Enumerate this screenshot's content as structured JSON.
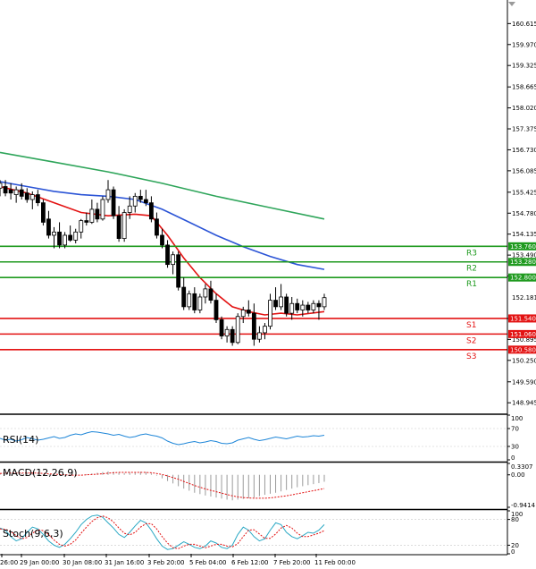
{
  "chart_data": {
    "type": "candlestick",
    "price_axis_ticks": [
      "160.615",
      "159.970",
      "159.325",
      "158.665",
      "158.020",
      "157.375",
      "156.730",
      "156.085",
      "155.425",
      "154.780",
      "154.135",
      "153.490",
      "152.845",
      "152.181",
      "151.540",
      "150.895",
      "150.250",
      "149.590",
      "148.945"
    ],
    "price_range": [
      148.62,
      161.12
    ],
    "current_price": "152.181",
    "time_labels": [
      "26:00",
      "29 Jan 00:00",
      "30 Jan 08:00",
      "31 Jan 16:00",
      "3 Feb 20:00",
      "5 Feb 04:00",
      "6 Feb 12:00",
      "7 Feb 20:00",
      "11 Feb 00:00"
    ],
    "levels": [
      {
        "name": "R3",
        "value": 153.76,
        "tag": "153.760",
        "kind": "resistance",
        "color": "#1f9a1f"
      },
      {
        "name": "R2",
        "value": 153.28,
        "tag": "153.280",
        "kind": "resistance",
        "color": "#1f9a1f"
      },
      {
        "name": "R1",
        "value": 152.8,
        "tag": "152.800",
        "kind": "resistance",
        "color": "#1f9a1f"
      },
      {
        "name": "S1",
        "value": 151.54,
        "tag": "151.540",
        "kind": "support",
        "color": "#e31212"
      },
      {
        "name": "S2",
        "value": 151.06,
        "tag": "151.060",
        "kind": "support",
        "color": "#e31212"
      },
      {
        "name": "S3",
        "value": 150.58,
        "tag": "150.580",
        "kind": "support",
        "color": "#e31212"
      }
    ],
    "candles": [
      {
        "o": 155.55,
        "h": 155.8,
        "l": 155.3,
        "c": 155.7
      },
      {
        "o": 155.6,
        "h": 155.8,
        "l": 155.3,
        "c": 155.4
      },
      {
        "o": 155.5,
        "h": 155.7,
        "l": 155.2,
        "c": 155.4
      },
      {
        "o": 155.35,
        "h": 155.6,
        "l": 155.1,
        "c": 155.5
      },
      {
        "o": 155.5,
        "h": 155.7,
        "l": 155.2,
        "c": 155.3
      },
      {
        "o": 155.4,
        "h": 155.55,
        "l": 155.1,
        "c": 155.2
      },
      {
        "o": 155.2,
        "h": 155.45,
        "l": 154.9,
        "c": 155.35
      },
      {
        "o": 155.35,
        "h": 155.5,
        "l": 155.0,
        "c": 155.1
      },
      {
        "o": 155.1,
        "h": 155.2,
        "l": 154.4,
        "c": 154.5
      },
      {
        "o": 154.6,
        "h": 154.85,
        "l": 154.0,
        "c": 154.1
      },
      {
        "o": 154.1,
        "h": 154.35,
        "l": 153.7,
        "c": 154.2
      },
      {
        "o": 154.2,
        "h": 154.5,
        "l": 153.7,
        "c": 153.8
      },
      {
        "o": 153.8,
        "h": 154.2,
        "l": 153.7,
        "c": 154.1
      },
      {
        "o": 154.1,
        "h": 154.4,
        "l": 153.9,
        "c": 153.95
      },
      {
        "o": 153.95,
        "h": 154.3,
        "l": 153.85,
        "c": 154.2
      },
      {
        "o": 154.2,
        "h": 154.6,
        "l": 154.0,
        "c": 154.55
      },
      {
        "o": 154.55,
        "h": 154.8,
        "l": 154.4,
        "c": 154.5
      },
      {
        "o": 154.5,
        "h": 155.2,
        "l": 154.45,
        "c": 154.9
      },
      {
        "o": 154.9,
        "h": 155.1,
        "l": 154.5,
        "c": 154.6
      },
      {
        "o": 154.6,
        "h": 155.3,
        "l": 154.55,
        "c": 155.2
      },
      {
        "o": 155.2,
        "h": 155.8,
        "l": 155.1,
        "c": 155.5
      },
      {
        "o": 155.5,
        "h": 155.6,
        "l": 154.6,
        "c": 154.7
      },
      {
        "o": 154.7,
        "h": 155.0,
        "l": 153.9,
        "c": 154.0
      },
      {
        "o": 154.0,
        "h": 154.9,
        "l": 153.9,
        "c": 154.8
      },
      {
        "o": 154.8,
        "h": 155.3,
        "l": 154.6,
        "c": 155.0
      },
      {
        "o": 155.0,
        "h": 155.4,
        "l": 154.8,
        "c": 155.3
      },
      {
        "o": 155.3,
        "h": 155.5,
        "l": 155.1,
        "c": 155.2
      },
      {
        "o": 155.2,
        "h": 155.5,
        "l": 155.0,
        "c": 155.1
      },
      {
        "o": 155.1,
        "h": 155.3,
        "l": 154.5,
        "c": 154.6
      },
      {
        "o": 154.6,
        "h": 154.8,
        "l": 154.0,
        "c": 154.1
      },
      {
        "o": 154.1,
        "h": 154.3,
        "l": 153.7,
        "c": 153.8
      },
      {
        "o": 153.8,
        "h": 153.95,
        "l": 153.1,
        "c": 153.2
      },
      {
        "o": 153.2,
        "h": 153.6,
        "l": 152.9,
        "c": 153.5
      },
      {
        "o": 153.5,
        "h": 153.6,
        "l": 152.4,
        "c": 152.5
      },
      {
        "o": 152.5,
        "h": 152.8,
        "l": 151.8,
        "c": 151.9
      },
      {
        "o": 151.9,
        "h": 152.4,
        "l": 151.8,
        "c": 152.3
      },
      {
        "o": 152.3,
        "h": 152.5,
        "l": 151.7,
        "c": 151.8
      },
      {
        "o": 151.8,
        "h": 152.3,
        "l": 151.7,
        "c": 152.2
      },
      {
        "o": 152.2,
        "h": 152.6,
        "l": 152.0,
        "c": 152.45
      },
      {
        "o": 152.45,
        "h": 152.7,
        "l": 152.0,
        "c": 152.1
      },
      {
        "o": 152.1,
        "h": 152.3,
        "l": 151.4,
        "c": 151.5
      },
      {
        "o": 151.5,
        "h": 151.6,
        "l": 150.9,
        "c": 151.0
      },
      {
        "o": 151.0,
        "h": 151.3,
        "l": 150.8,
        "c": 151.2
      },
      {
        "o": 151.2,
        "h": 151.3,
        "l": 150.7,
        "c": 150.8
      },
      {
        "o": 150.8,
        "h": 151.7,
        "l": 150.75,
        "c": 151.6
      },
      {
        "o": 151.6,
        "h": 151.9,
        "l": 151.4,
        "c": 151.8
      },
      {
        "o": 151.8,
        "h": 152.1,
        "l": 151.6,
        "c": 151.7
      },
      {
        "o": 151.7,
        "h": 152.0,
        "l": 150.7,
        "c": 150.9
      },
      {
        "o": 150.9,
        "h": 151.3,
        "l": 150.8,
        "c": 151.1
      },
      {
        "o": 151.1,
        "h": 151.4,
        "l": 150.9,
        "c": 151.3
      },
      {
        "o": 151.3,
        "h": 152.3,
        "l": 151.2,
        "c": 152.1
      },
      {
        "o": 152.1,
        "h": 152.5,
        "l": 151.8,
        "c": 151.9
      },
      {
        "o": 151.9,
        "h": 152.6,
        "l": 151.8,
        "c": 152.2
      },
      {
        "o": 152.2,
        "h": 152.3,
        "l": 151.6,
        "c": 151.7
      },
      {
        "o": 151.7,
        "h": 152.2,
        "l": 151.5,
        "c": 152.0
      },
      {
        "o": 152.0,
        "h": 152.15,
        "l": 151.7,
        "c": 151.8
      },
      {
        "o": 151.8,
        "h": 152.1,
        "l": 151.6,
        "c": 151.95
      },
      {
        "o": 151.95,
        "h": 152.05,
        "l": 151.7,
        "c": 151.8
      },
      {
        "o": 151.8,
        "h": 152.1,
        "l": 151.7,
        "c": 152.0
      },
      {
        "o": 152.0,
        "h": 152.1,
        "l": 151.5,
        "c": 151.9
      },
      {
        "o": 151.9,
        "h": 152.3,
        "l": 151.8,
        "c": 152.18
      }
    ],
    "moving_averages": [
      {
        "color": "#e31212",
        "points": [
          [
            0,
            155.6
          ],
          [
            5,
            155.4
          ],
          [
            10,
            155.1
          ],
          [
            15,
            154.8
          ],
          [
            20,
            154.7
          ],
          [
            25,
            154.75
          ],
          [
            28,
            154.7
          ],
          [
            31,
            154.1
          ],
          [
            34,
            153.4
          ],
          [
            37,
            152.8
          ],
          [
            40,
            152.3
          ],
          [
            43,
            151.9
          ],
          [
            46,
            151.75
          ],
          [
            49,
            151.65
          ],
          [
            52,
            151.7
          ],
          [
            55,
            151.65
          ],
          [
            60,
            151.75
          ]
        ]
      },
      {
        "color": "#2b54d6",
        "points": [
          [
            0,
            155.75
          ],
          [
            5,
            155.6
          ],
          [
            10,
            155.45
          ],
          [
            15,
            155.35
          ],
          [
            20,
            155.3
          ],
          [
            25,
            155.2
          ],
          [
            30,
            154.9
          ],
          [
            35,
            154.5
          ],
          [
            40,
            154.1
          ],
          [
            45,
            153.75
          ],
          [
            50,
            153.45
          ],
          [
            55,
            153.2
          ],
          [
            60,
            153.05
          ]
        ]
      },
      {
        "color": "#2ea55a",
        "points": [
          [
            0,
            156.65
          ],
          [
            10,
            156.35
          ],
          [
            20,
            156.05
          ],
          [
            30,
            155.7
          ],
          [
            40,
            155.3
          ],
          [
            50,
            154.95
          ],
          [
            60,
            154.6
          ]
        ]
      }
    ],
    "indicators": [
      {
        "name": "RSI(14)",
        "ticks": [
          "100",
          "70",
          "30",
          "0"
        ],
        "range": [
          0,
          100
        ],
        "color": "#1e86d8",
        "values": [
          48,
          44,
          46,
          42,
          45,
          50,
          47,
          44,
          46,
          49,
          52,
          48,
          50,
          55,
          58,
          56,
          60,
          63,
          62,
          60,
          58,
          55,
          57,
          53,
          50,
          52,
          56,
          58,
          55,
          53,
          49,
          42,
          37,
          34,
          36,
          39,
          41,
          38,
          40,
          43,
          41,
          37,
          36,
          38,
          44,
          47,
          50,
          46,
          43,
          45,
          48,
          51,
          49,
          47,
          50,
          53,
          51,
          52,
          54,
          53,
          55
        ]
      },
      {
        "name": "MACD(12,26,9)",
        "ticks": [
          "0.3307",
          "0.00",
          "-0.9414"
        ],
        "range": [
          -0.9414,
          0.3307
        ],
        "hist_color": "#9a9a9a",
        "signal_color": "#e31212",
        "values": [
          0.05,
          0.06,
          0.04,
          0.03,
          0.05,
          0.07,
          0.06,
          0.04,
          0.02,
          0.01,
          0.0,
          -0.01,
          -0.02,
          -0.02,
          -0.01,
          0.0,
          0.02,
          0.04,
          0.06,
          0.08,
          0.1,
          0.09,
          0.07,
          0.05,
          0.06,
          0.08,
          0.09,
          0.08,
          0.04,
          -0.02,
          -0.1,
          -0.18,
          -0.25,
          -0.33,
          -0.4,
          -0.46,
          -0.52,
          -0.56,
          -0.6,
          -0.63,
          -0.66,
          -0.69,
          -0.72,
          -0.74,
          -0.72,
          -0.7,
          -0.68,
          -0.66,
          -0.62,
          -0.58,
          -0.55,
          -0.52,
          -0.48,
          -0.44,
          -0.4,
          -0.36,
          -0.33,
          -0.3,
          -0.27,
          -0.24,
          -0.2
        ],
        "signal": [
          0.04,
          0.05,
          0.05,
          0.05,
          0.05,
          0.05,
          0.05,
          0.05,
          0.04,
          0.03,
          0.02,
          0.01,
          0.0,
          -0.01,
          -0.01,
          -0.01,
          0.0,
          0.01,
          0.02,
          0.03,
          0.05,
          0.06,
          0.07,
          0.07,
          0.07,
          0.07,
          0.07,
          0.07,
          0.06,
          0.04,
          0.01,
          -0.03,
          -0.08,
          -0.13,
          -0.19,
          -0.25,
          -0.31,
          -0.36,
          -0.41,
          -0.45,
          -0.49,
          -0.53,
          -0.57,
          -0.61,
          -0.64,
          -0.66,
          -0.67,
          -0.68,
          -0.68,
          -0.68,
          -0.67,
          -0.65,
          -0.63,
          -0.61,
          -0.58,
          -0.55,
          -0.52,
          -0.49,
          -0.46,
          -0.43,
          -0.4
        ]
      },
      {
        "name": "Stoch(9,6,3)",
        "ticks": [
          "100",
          "80",
          "20",
          "0"
        ],
        "range": [
          0,
          100
        ],
        "main_color": "#2aa8c4",
        "signal_color": "#e31212",
        "values": [
          60,
          55,
          40,
          30,
          35,
          50,
          62,
          58,
          45,
          30,
          20,
          15,
          22,
          35,
          50,
          68,
          80,
          88,
          90,
          85,
          72,
          60,
          45,
          38,
          50,
          65,
          78,
          72,
          55,
          35,
          18,
          10,
          12,
          20,
          28,
          22,
          15,
          12,
          18,
          30,
          25,
          15,
          12,
          20,
          45,
          62,
          55,
          40,
          30,
          35,
          55,
          72,
          68,
          50,
          40,
          35,
          42,
          50,
          48,
          55,
          68
        ],
        "signal": [
          58,
          57,
          52,
          42,
          35,
          38,
          48,
          56,
          54,
          45,
          32,
          22,
          18,
          22,
          32,
          48,
          62,
          75,
          84,
          88,
          84,
          74,
          60,
          48,
          44,
          50,
          62,
          70,
          70,
          58,
          40,
          25,
          14,
          12,
          18,
          22,
          22,
          18,
          14,
          18,
          22,
          22,
          18,
          16,
          24,
          40,
          55,
          56,
          46,
          36,
          36,
          46,
          60,
          66,
          60,
          48,
          40,
          40,
          44,
          48,
          54
        ]
      }
    ]
  }
}
